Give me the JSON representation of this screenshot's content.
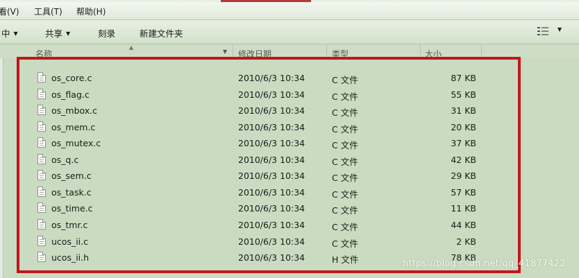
{
  "menu": {
    "view": "看(V)",
    "tools": "工具(T)",
    "help": "帮助(H)"
  },
  "toolbar": {
    "organize_label": "中",
    "share_label": "共享",
    "burn_label": "刻录",
    "new_folder_label": "新建文件夹",
    "view_icon": "details-view-icon"
  },
  "columns": {
    "name": "名称",
    "date": "修改日期",
    "type": "类型",
    "size": "大小"
  },
  "files": [
    {
      "name": "os_core.c",
      "date": "2010/6/3 10:34",
      "type": "C 文件",
      "size": "87 KB"
    },
    {
      "name": "os_flag.c",
      "date": "2010/6/3 10:34",
      "type": "C 文件",
      "size": "55 KB"
    },
    {
      "name": "os_mbox.c",
      "date": "2010/6/3 10:34",
      "type": "C 文件",
      "size": "31 KB"
    },
    {
      "name": "os_mem.c",
      "date": "2010/6/3 10:34",
      "type": "C 文件",
      "size": "20 KB"
    },
    {
      "name": "os_mutex.c",
      "date": "2010/6/3 10:34",
      "type": "C 文件",
      "size": "37 KB"
    },
    {
      "name": "os_q.c",
      "date": "2010/6/3 10:34",
      "type": "C 文件",
      "size": "42 KB"
    },
    {
      "name": "os_sem.c",
      "date": "2010/6/3 10:34",
      "type": "C 文件",
      "size": "29 KB"
    },
    {
      "name": "os_task.c",
      "date": "2010/6/3 10:34",
      "type": "C 文件",
      "size": "57 KB"
    },
    {
      "name": "os_time.c",
      "date": "2010/6/3 10:34",
      "type": "C 文件",
      "size": "11 KB"
    },
    {
      "name": "os_tmr.c",
      "date": "2010/6/3 10:34",
      "type": "C 文件",
      "size": "44 KB"
    },
    {
      "name": "ucos_ii.c",
      "date": "2010/6/3 10:34",
      "type": "C 文件",
      "size": "2 KB"
    },
    {
      "name": "ucos_ii.h",
      "date": "2010/6/3 10:34",
      "type": "H 文件",
      "size": "78 KB"
    }
  ],
  "watermark": "https://blog.csdn.net/qq_41877422",
  "colors": {
    "background": "#c9dbc0",
    "highlight_box": "#c2151b"
  }
}
